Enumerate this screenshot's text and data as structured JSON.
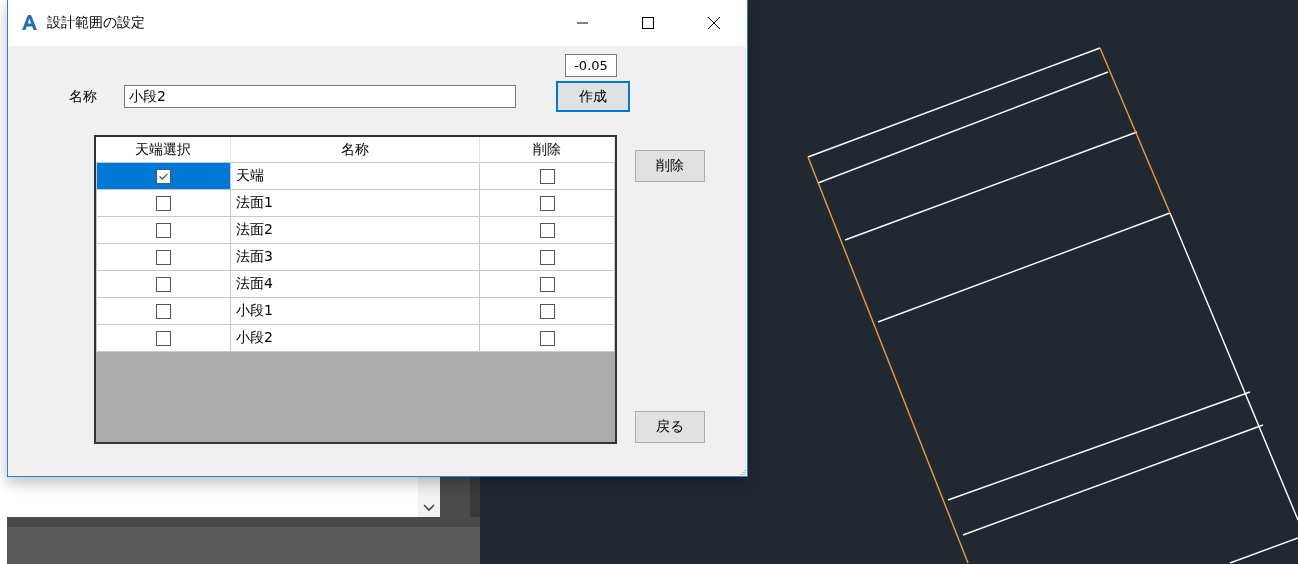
{
  "window": {
    "title": "設計範囲の設定"
  },
  "offset_field": {
    "value": "-0.05"
  },
  "name_label": "名称",
  "name_field": {
    "value": "小段2"
  },
  "create_button": {
    "label": "作成",
    "focused": true
  },
  "table": {
    "columns": [
      "天端選択",
      "名称",
      "削除"
    ],
    "rows": [
      {
        "top_selected": true,
        "name": "天端",
        "delete": false,
        "selected": true
      },
      {
        "top_selected": false,
        "name": "法面1",
        "delete": false,
        "selected": false
      },
      {
        "top_selected": false,
        "name": "法面2",
        "delete": false,
        "selected": false
      },
      {
        "top_selected": false,
        "name": "法面3",
        "delete": false,
        "selected": false
      },
      {
        "top_selected": false,
        "name": "法面4",
        "delete": false,
        "selected": false
      },
      {
        "top_selected": false,
        "name": "小段1",
        "delete": false,
        "selected": false
      },
      {
        "top_selected": false,
        "name": "小段2",
        "delete": false,
        "selected": false
      }
    ]
  },
  "delete_button": "削除",
  "back_button": "戻る"
}
